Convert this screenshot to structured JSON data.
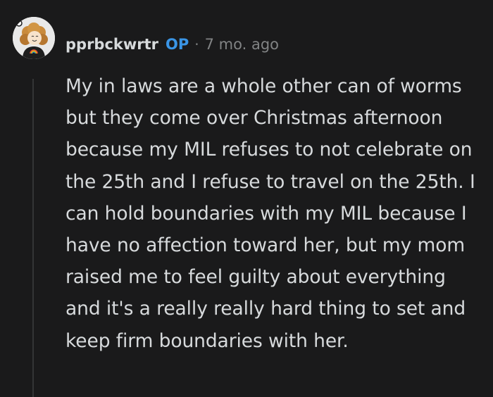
{
  "comment": {
    "username": "pprbckwrtr",
    "op_badge": "OP",
    "separator": "·",
    "timestamp": "7 mo. ago",
    "avatar_icon": "avatar-icon",
    "body": "My in laws are a whole other can of worms but they come over Christmas afternoon because my MIL refuses to not celebrate on the 25th and I refuse to travel on the 25th. I can hold boundaries with my MIL because I have no affection toward her, but my mom raised me to feel guilty about everything and it's a really really hard thing to set and keep firm boundaries with her."
  },
  "colors": {
    "background": "#1a1a1b",
    "text": "#d7dadc",
    "meta": "#818384",
    "op": "#3a95e6",
    "thread_line": "#343536"
  }
}
